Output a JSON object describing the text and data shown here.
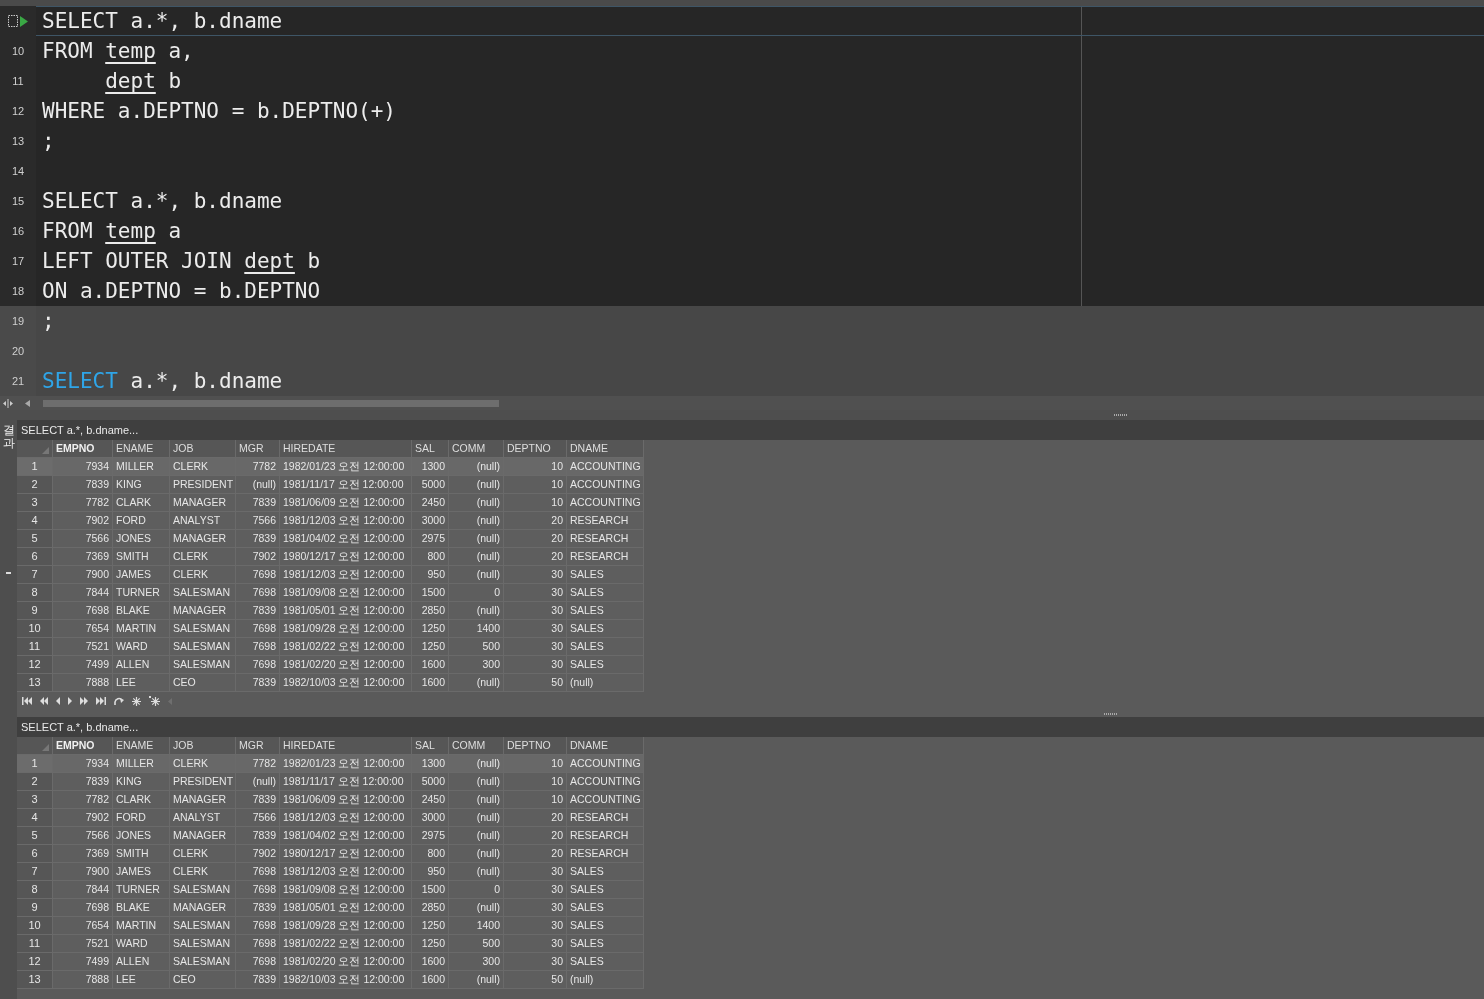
{
  "editor": {
    "statement_lines": [
      {
        "current": true,
        "segments": [
          {
            "kind": "text",
            "text": "SELECT a.*, b.dname"
          }
        ]
      },
      {
        "number": "10",
        "current": false,
        "segments": [
          {
            "kind": "text",
            "text": "FROM "
          },
          {
            "kind": "table",
            "text": "temp"
          },
          {
            "kind": "text",
            "text": " a,"
          }
        ]
      },
      {
        "number": "11",
        "current": false,
        "indent": true,
        "segments": [
          {
            "kind": "table",
            "text": "dept"
          },
          {
            "kind": "text",
            "text": " b"
          }
        ]
      },
      {
        "number": "12",
        "current": false,
        "segments": [
          {
            "kind": "text",
            "text": "WHERE a.DEPTNO = b.DEPTNO(+)"
          }
        ]
      },
      {
        "number": "13",
        "current": false,
        "segments": [
          {
            "kind": "text",
            "text": ";"
          }
        ]
      },
      {
        "number": "14",
        "current": false
      },
      {
        "number": "15",
        "current": false,
        "segments": [
          {
            "kind": "text",
            "text": "SELECT a.*, b.dname"
          }
        ]
      },
      {
        "number": "16",
        "current": false,
        "segments": [
          {
            "kind": "text",
            "text": "FROM "
          },
          {
            "kind": "table",
            "text": "temp"
          },
          {
            "kind": "text",
            "text": " a"
          }
        ]
      },
      {
        "number": "17",
        "current": false,
        "segments": [
          {
            "kind": "text",
            "text": "LEFT OUTER JOIN "
          },
          {
            "kind": "table",
            "text": "dept"
          },
          {
            "kind": "text",
            "text": " b"
          }
        ]
      },
      {
        "number": "18",
        "current": false,
        "segments": [
          {
            "kind": "text",
            "text": "ON a.DEPTNO = b.DEPTNO"
          }
        ]
      }
    ],
    "other_lines": [
      {
        "number": "19",
        "segments": [
          {
            "kind": "text",
            "text": ";"
          }
        ]
      },
      {
        "number": "20"
      },
      {
        "number": "21",
        "segments": [
          {
            "kind": "keyword",
            "text": "SELECT"
          },
          {
            "kind": "text",
            "text": " a.*, b.dname"
          }
        ]
      }
    ]
  },
  "results": {
    "tab_label": "결과",
    "panels": [
      {
        "title": "SELECT a.*, b.dname...",
        "columns": [
          {
            "label": "EMPNO",
            "primary": true
          },
          {
            "label": "ENAME",
            "primary": false
          },
          {
            "label": "JOB",
            "primary": false
          },
          {
            "label": "MGR",
            "primary": false
          },
          {
            "label": "HIREDATE",
            "primary": false
          },
          {
            "label": "SAL",
            "primary": false
          },
          {
            "label": "COMM",
            "primary": false
          },
          {
            "label": "DEPTNO",
            "primary": false
          },
          {
            "label": "DNAME",
            "primary": false
          }
        ],
        "navigator": true,
        "rows": [
          {
            "number": "1",
            "selected": true,
            "cells": [
              "7934",
              "MILLER",
              "CLERK",
              "7782",
              "1982/01/23 오전 12:00:00",
              "1300",
              "(null)",
              "10",
              "ACCOUNTING"
            ]
          },
          {
            "number": "2",
            "selected": false,
            "cells": [
              "7839",
              "KING",
              "PRESIDENT",
              "(null)",
              "1981/11/17 오전 12:00:00",
              "5000",
              "(null)",
              "10",
              "ACCOUNTING"
            ]
          },
          {
            "number": "3",
            "selected": false,
            "cells": [
              "7782",
              "CLARK",
              "MANAGER",
              "7839",
              "1981/06/09 오전 12:00:00",
              "2450",
              "(null)",
              "10",
              "ACCOUNTING"
            ]
          },
          {
            "number": "4",
            "selected": false,
            "cells": [
              "7902",
              "FORD",
              "ANALYST",
              "7566",
              "1981/12/03 오전 12:00:00",
              "3000",
              "(null)",
              "20",
              "RESEARCH"
            ]
          },
          {
            "number": "5",
            "selected": false,
            "cells": [
              "7566",
              "JONES",
              "MANAGER",
              "7839",
              "1981/04/02 오전 12:00:00",
              "2975",
              "(null)",
              "20",
              "RESEARCH"
            ]
          },
          {
            "number": "6",
            "selected": false,
            "cells": [
              "7369",
              "SMITH",
              "CLERK",
              "7902",
              "1980/12/17 오전 12:00:00",
              "800",
              "(null)",
              "20",
              "RESEARCH"
            ]
          },
          {
            "number": "7",
            "selected": false,
            "cells": [
              "7900",
              "JAMES",
              "CLERK",
              "7698",
              "1981/12/03 오전 12:00:00",
              "950",
              "(null)",
              "30",
              "SALES"
            ]
          },
          {
            "number": "8",
            "selected": false,
            "cells": [
              "7844",
              "TURNER",
              "SALESMAN",
              "7698",
              "1981/09/08 오전 12:00:00",
              "1500",
              "0",
              "30",
              "SALES"
            ]
          },
          {
            "number": "9",
            "selected": false,
            "cells": [
              "7698",
              "BLAKE",
              "MANAGER",
              "7839",
              "1981/05/01 오전 12:00:00",
              "2850",
              "(null)",
              "30",
              "SALES"
            ]
          },
          {
            "number": "10",
            "selected": false,
            "cells": [
              "7654",
              "MARTIN",
              "SALESMAN",
              "7698",
              "1981/09/28 오전 12:00:00",
              "1250",
              "1400",
              "30",
              "SALES"
            ]
          },
          {
            "number": "11",
            "selected": false,
            "cells": [
              "7521",
              "WARD",
              "SALESMAN",
              "7698",
              "1981/02/22 오전 12:00:00",
              "1250",
              "500",
              "30",
              "SALES"
            ]
          },
          {
            "number": "12",
            "selected": false,
            "cells": [
              "7499",
              "ALLEN",
              "SALESMAN",
              "7698",
              "1981/02/20 오전 12:00:00",
              "1600",
              "300",
              "30",
              "SALES"
            ]
          },
          {
            "number": "13",
            "selected": false,
            "cells": [
              "7888",
              "LEE",
              "CEO",
              "7839",
              "1982/10/03 오전 12:00:00",
              "1600",
              "(null)",
              "50",
              "(null)"
            ]
          }
        ]
      },
      {
        "title": "SELECT a.*, b.dname...",
        "columns": [
          {
            "label": "EMPNO",
            "primary": true
          },
          {
            "label": "ENAME",
            "primary": false
          },
          {
            "label": "JOB",
            "primary": false
          },
          {
            "label": "MGR",
            "primary": false
          },
          {
            "label": "HIREDATE",
            "primary": false
          },
          {
            "label": "SAL",
            "primary": false
          },
          {
            "label": "COMM",
            "primary": false
          },
          {
            "label": "DEPTNO",
            "primary": false
          },
          {
            "label": "DNAME",
            "primary": false
          }
        ],
        "navigator": false,
        "rows": [
          {
            "number": "1",
            "selected": true,
            "cells": [
              "7934",
              "MILLER",
              "CLERK",
              "7782",
              "1982/01/23 오전 12:00:00",
              "1300",
              "(null)",
              "10",
              "ACCOUNTING"
            ]
          },
          {
            "number": "2",
            "selected": false,
            "cells": [
              "7839",
              "KING",
              "PRESIDENT",
              "(null)",
              "1981/11/17 오전 12:00:00",
              "5000",
              "(null)",
              "10",
              "ACCOUNTING"
            ]
          },
          {
            "number": "3",
            "selected": false,
            "cells": [
              "7782",
              "CLARK",
              "MANAGER",
              "7839",
              "1981/06/09 오전 12:00:00",
              "2450",
              "(null)",
              "10",
              "ACCOUNTING"
            ]
          },
          {
            "number": "4",
            "selected": false,
            "cells": [
              "7902",
              "FORD",
              "ANALYST",
              "7566",
              "1981/12/03 오전 12:00:00",
              "3000",
              "(null)",
              "20",
              "RESEARCH"
            ]
          },
          {
            "number": "5",
            "selected": false,
            "cells": [
              "7566",
              "JONES",
              "MANAGER",
              "7839",
              "1981/04/02 오전 12:00:00",
              "2975",
              "(null)",
              "20",
              "RESEARCH"
            ]
          },
          {
            "number": "6",
            "selected": false,
            "cells": [
              "7369",
              "SMITH",
              "CLERK",
              "7902",
              "1980/12/17 오전 12:00:00",
              "800",
              "(null)",
              "20",
              "RESEARCH"
            ]
          },
          {
            "number": "7",
            "selected": false,
            "cells": [
              "7900",
              "JAMES",
              "CLERK",
              "7698",
              "1981/12/03 오전 12:00:00",
              "950",
              "(null)",
              "30",
              "SALES"
            ]
          },
          {
            "number": "8",
            "selected": false,
            "cells": [
              "7844",
              "TURNER",
              "SALESMAN",
              "7698",
              "1981/09/08 오전 12:00:00",
              "1500",
              "0",
              "30",
              "SALES"
            ]
          },
          {
            "number": "9",
            "selected": false,
            "cells": [
              "7698",
              "BLAKE",
              "MANAGER",
              "7839",
              "1981/05/01 오전 12:00:00",
              "2850",
              "(null)",
              "30",
              "SALES"
            ]
          },
          {
            "number": "10",
            "selected": false,
            "cells": [
              "7654",
              "MARTIN",
              "SALESMAN",
              "7698",
              "1981/09/28 오전 12:00:00",
              "1250",
              "1400",
              "30",
              "SALES"
            ]
          },
          {
            "number": "11",
            "selected": false,
            "cells": [
              "7521",
              "WARD",
              "SALESMAN",
              "7698",
              "1981/02/22 오전 12:00:00",
              "1250",
              "500",
              "30",
              "SALES"
            ]
          },
          {
            "number": "12",
            "selected": false,
            "cells": [
              "7499",
              "ALLEN",
              "SALESMAN",
              "7698",
              "1981/02/20 오전 12:00:00",
              "1600",
              "300",
              "30",
              "SALES"
            ]
          },
          {
            "number": "13",
            "selected": false,
            "cells": [
              "7888",
              "LEE",
              "CEO",
              "7839",
              "1982/10/03 오전 12:00:00",
              "1600",
              "(null)",
              "50",
              "(null)"
            ]
          }
        ]
      }
    ]
  }
}
